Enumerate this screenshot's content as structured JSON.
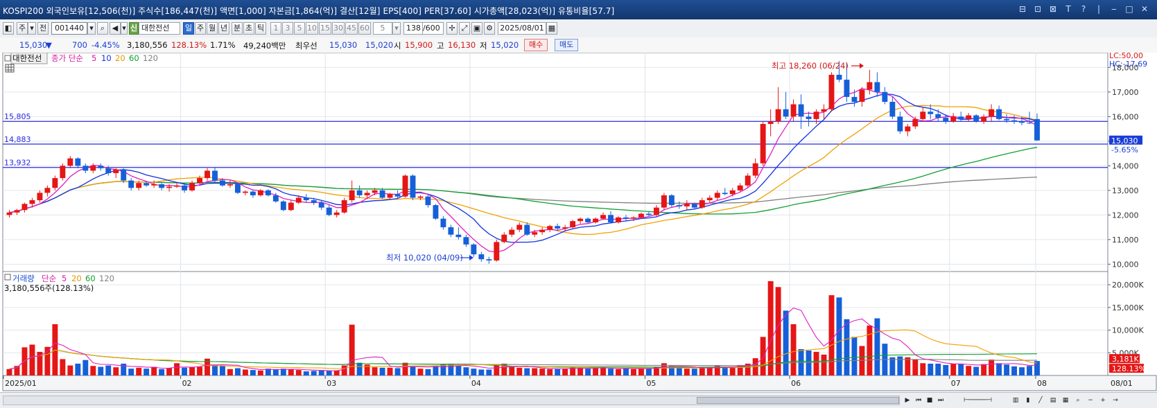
{
  "window": {
    "title": "KOSPI200 외국인보유[12,506(천)] 주식수[186,447(천)] 액면[1,000] 자본금[1,864(억)] 결산[12월] EPS[400] PER[37.60] 시가총액[28,023(억)] 유통비율[57.7]"
  },
  "toolbar": {
    "mode_ju": "주",
    "mode_jeon": "전",
    "stock_code": "001440",
    "new_badge": "신",
    "stock_name": "대한전선",
    "periods": [
      "일",
      "주",
      "월",
      "년",
      "분",
      "초",
      "틱"
    ],
    "period_active": "일",
    "intervals": [
      "1",
      "3",
      "5",
      "10",
      "15",
      "30",
      "45",
      "60"
    ],
    "interval_value": "5",
    "count": "138",
    "count_total": "/600",
    "date": "2025/08/01"
  },
  "quote": {
    "price": "15,030",
    "change_arrow": "▼",
    "change": "700",
    "change_pct": "-4.45%",
    "volume": "3,180,556",
    "volume_ratio": "128.13%",
    "turnover": "1.71%",
    "trade_value": "49,240백만",
    "best_label": "최우선",
    "best_ask": "15,030",
    "best_bid": "15,020",
    "open_label": "시",
    "open": "15,900",
    "high_label": "고",
    "high": "16,130",
    "low_label": "저",
    "low": "15,020",
    "buy_label": "매수",
    "sell_label": "매도"
  },
  "price_pane": {
    "stock_tag": "대한전선",
    "legend_prefix": "종가 단순",
    "ma_periods": [
      "5",
      "10",
      "20",
      "60",
      "120"
    ],
    "ma_colors": [
      "#e020c0",
      "#1030e0",
      "#f0a000",
      "#10a030",
      "#808080"
    ],
    "lc_label": "LC:50,00",
    "hc_label": "HC:-17,69",
    "hlines": [
      "15,805",
      "14,883",
      "13,932"
    ],
    "current_price_tag": "15,030",
    "current_pct_tag": "-5.65%",
    "high_annotation": "최고 18,260 (06/24)",
    "low_annotation": "최저 10,020 (04/09)",
    "y_ticks": [
      "18,000",
      "17,000",
      "16,000",
      "15,000",
      "14,000",
      "13,000",
      "12,000",
      "11,000",
      "10,000"
    ]
  },
  "volume_pane": {
    "legend_prefix": "거래량",
    "legend_simple": "단순",
    "ma_periods": [
      "5",
      "20",
      "60",
      "120"
    ],
    "volume_readout": "3,180,556주(128.13%)",
    "y_ticks": [
      "20,000K",
      "15,000K",
      "10,000K",
      "5,000K"
    ],
    "current_tag": "3,181K",
    "current_pct": "128.13%"
  },
  "x_axis": {
    "labels": [
      "2025/01",
      "02",
      "03",
      "04",
      "05",
      "06",
      "07",
      "08",
      "08/01"
    ]
  },
  "chart_data": {
    "type": "candlestick",
    "y_range": [
      9700,
      18600
    ],
    "up_color": "#e51616",
    "down_color": "#1560d8",
    "candles": [
      [
        12000,
        12200,
        11900,
        12100
      ],
      [
        12100,
        12250,
        12000,
        12200
      ],
      [
        12200,
        12500,
        12100,
        12450
      ],
      [
        12450,
        12700,
        12300,
        12600
      ],
      [
        12600,
        13000,
        12500,
        12900
      ],
      [
        12900,
        13200,
        12750,
        13100
      ],
      [
        13100,
        13600,
        13000,
        13500
      ],
      [
        13500,
        14100,
        13400,
        14000
      ],
      [
        14000,
        14400,
        13900,
        14300
      ],
      [
        14300,
        14350,
        13900,
        14000
      ],
      [
        14000,
        14100,
        13700,
        13800
      ],
      [
        13800,
        14100,
        13700,
        14000
      ],
      [
        14000,
        14100,
        13800,
        13900
      ],
      [
        13900,
        14000,
        13600,
        13700
      ],
      [
        13700,
        13900,
        13500,
        13850
      ],
      [
        13850,
        13900,
        13300,
        13400
      ],
      [
        13400,
        13500,
        13000,
        13100
      ],
      [
        13100,
        13400,
        13000,
        13300
      ],
      [
        13300,
        13350,
        13150,
        13200
      ],
      [
        13200,
        13400,
        13100,
        13250
      ],
      [
        13250,
        13300,
        13000,
        13100
      ],
      [
        13100,
        13250,
        12950,
        13150
      ],
      [
        13150,
        13300,
        13100,
        13200
      ],
      [
        13200,
        13250,
        12900,
        13000
      ],
      [
        13000,
        13400,
        12950,
        13300
      ],
      [
        13300,
        13600,
        13250,
        13500
      ],
      [
        13500,
        13900,
        13400,
        13800
      ],
      [
        13800,
        13950,
        13300,
        13400
      ],
      [
        13400,
        13500,
        13150,
        13200
      ],
      [
        13200,
        13400,
        13100,
        13250
      ],
      [
        13250,
        13300,
        12850,
        12900
      ],
      [
        12900,
        13000,
        12800,
        12950
      ],
      [
        12950,
        13000,
        12700,
        12800
      ],
      [
        12800,
        13050,
        12750,
        13000
      ],
      [
        13000,
        13050,
        12750,
        12800
      ],
      [
        12800,
        12900,
        12500,
        12550
      ],
      [
        12550,
        12600,
        12150,
        12200
      ],
      [
        12200,
        12600,
        12150,
        12500
      ],
      [
        12500,
        12800,
        12450,
        12700
      ],
      [
        12700,
        12850,
        12500,
        12600
      ],
      [
        12600,
        12700,
        12400,
        12500
      ],
      [
        12500,
        12600,
        12200,
        12300
      ],
      [
        12300,
        12400,
        11950,
        12000
      ],
      [
        12000,
        12200,
        11900,
        12100
      ],
      [
        12100,
        12700,
        12050,
        12600
      ],
      [
        12600,
        13400,
        12500,
        13000
      ],
      [
        13000,
        13200,
        12700,
        12800
      ],
      [
        12800,
        13000,
        12650,
        12900
      ],
      [
        12900,
        13100,
        12800,
        13000
      ],
      [
        13000,
        13100,
        12650,
        12700
      ],
      [
        12700,
        12900,
        12650,
        12850
      ],
      [
        12850,
        13000,
        12700,
        12750
      ],
      [
        12750,
        13650,
        12700,
        13600
      ],
      [
        13600,
        13650,
        12600,
        12700
      ],
      [
        12700,
        12800,
        12600,
        12750
      ],
      [
        12750,
        12850,
        12300,
        12400
      ],
      [
        12400,
        12450,
        11800,
        11850
      ],
      [
        11850,
        11950,
        11400,
        11500
      ],
      [
        11500,
        11600,
        11100,
        11200
      ],
      [
        11200,
        11500,
        11000,
        11100
      ],
      [
        11100,
        11200,
        10700,
        10800
      ],
      [
        10800,
        10850,
        10300,
        10400
      ],
      [
        10400,
        10500,
        10100,
        10200
      ],
      [
        10200,
        10300,
        10020,
        10150
      ],
      [
        10150,
        11000,
        10100,
        10900
      ],
      [
        10900,
        11300,
        10850,
        11200
      ],
      [
        11200,
        11500,
        11100,
        11400
      ],
      [
        11400,
        11700,
        11300,
        11600
      ],
      [
        11600,
        11700,
        11150,
        11200
      ],
      [
        11200,
        11400,
        11100,
        11300
      ],
      [
        11300,
        11500,
        11200,
        11400
      ],
      [
        11400,
        11600,
        11300,
        11550
      ],
      [
        11550,
        11650,
        11350,
        11450
      ],
      [
        11450,
        11600,
        11350,
        11500
      ],
      [
        11500,
        11800,
        11450,
        11750
      ],
      [
        11750,
        11900,
        11650,
        11850
      ],
      [
        11850,
        11900,
        11650,
        11700
      ],
      [
        11700,
        11900,
        11650,
        11850
      ],
      [
        11850,
        12100,
        11800,
        12000
      ],
      [
        12000,
        12150,
        11650,
        11700
      ],
      [
        11700,
        11950,
        11650,
        11900
      ],
      [
        11900,
        12000,
        11750,
        11850
      ],
      [
        11850,
        11950,
        11750,
        11900
      ],
      [
        11900,
        12100,
        11850,
        12050
      ],
      [
        12050,
        12150,
        11950,
        12000
      ],
      [
        12000,
        12400,
        11950,
        12300
      ],
      [
        12300,
        12900,
        12200,
        12800
      ],
      [
        12800,
        12850,
        12300,
        12400
      ],
      [
        12400,
        12550,
        12250,
        12350
      ],
      [
        12350,
        12600,
        12200,
        12450
      ],
      [
        12450,
        12500,
        12250,
        12300
      ],
      [
        12300,
        12700,
        12250,
        12600
      ],
      [
        12600,
        12800,
        12500,
        12700
      ],
      [
        12700,
        13000,
        12600,
        12900
      ],
      [
        12900,
        13100,
        12800,
        12850
      ],
      [
        12850,
        13100,
        12750,
        13000
      ],
      [
        13000,
        13300,
        12950,
        13200
      ],
      [
        13200,
        13700,
        13100,
        13600
      ],
      [
        13600,
        14300,
        13500,
        14100
      ],
      [
        14100,
        15800,
        14000,
        15700
      ],
      [
        15700,
        16300,
        15200,
        15800
      ],
      [
        15800,
        17200,
        15700,
        16300
      ],
      [
        16300,
        17000,
        15900,
        16000
      ],
      [
        16000,
        16700,
        15800,
        16500
      ],
      [
        16500,
        16900,
        15500,
        16000
      ],
      [
        16000,
        16200,
        15600,
        15900
      ],
      [
        15900,
        16300,
        15700,
        16200
      ],
      [
        16200,
        16500,
        15900,
        16300
      ],
      [
        16300,
        17800,
        16200,
        17700
      ],
      [
        17700,
        18260,
        17400,
        17500
      ],
      [
        17500,
        18200,
        16600,
        16800
      ],
      [
        16800,
        17100,
        16400,
        16600
      ],
      [
        16600,
        17200,
        16400,
        17100
      ],
      [
        17100,
        17900,
        16900,
        17400
      ],
      [
        17400,
        17800,
        16800,
        17000
      ],
      [
        17000,
        17200,
        16500,
        16600
      ],
      [
        16600,
        16800,
        15900,
        16000
      ],
      [
        16000,
        16200,
        15300,
        15400
      ],
      [
        15400,
        15700,
        15200,
        15600
      ],
      [
        15600,
        16000,
        15500,
        15900
      ],
      [
        15900,
        16400,
        15800,
        16200
      ],
      [
        16200,
        16500,
        15900,
        16100
      ],
      [
        16100,
        16300,
        15800,
        15950
      ],
      [
        15950,
        16100,
        15700,
        15800
      ],
      [
        15800,
        16150,
        15750,
        16000
      ],
      [
        16000,
        16200,
        15800,
        15900
      ],
      [
        15900,
        16150,
        15800,
        16050
      ],
      [
        16050,
        16100,
        15750,
        15800
      ],
      [
        15800,
        16100,
        15700,
        16000
      ],
      [
        16000,
        16500,
        15800,
        16300
      ],
      [
        16300,
        16450,
        15850,
        15900
      ],
      [
        15900,
        16100,
        15750,
        15850
      ],
      [
        15850,
        16050,
        15700,
        15800
      ],
      [
        15800,
        16000,
        15650,
        15750
      ],
      [
        15750,
        16200,
        15700,
        15730
      ],
      [
        15900,
        16130,
        15020,
        15030
      ]
    ],
    "volumes_k": [
      1400,
      2100,
      6200,
      6800,
      5200,
      6300,
      11300,
      3600,
      2200,
      2600,
      3400,
      2100,
      1900,
      2200,
      1800,
      2600,
      1500,
      1700,
      1500,
      1900,
      1400,
      1600,
      2700,
      1700,
      1800,
      1900,
      3700,
      2400,
      2100,
      1400,
      1600,
      1300,
      1200,
      1100,
      1500,
      1400,
      1500,
      1300,
      1200,
      900,
      1000,
      1200,
      1000,
      1100,
      2200,
      11200,
      2800,
      2400,
      1800,
      1700,
      1700,
      1600,
      2800,
      2000,
      1500,
      1400,
      2100,
      2400,
      2600,
      2100,
      1800,
      1500,
      1300,
      1300,
      2400,
      2600,
      1900,
      1700,
      1600,
      1600,
      1500,
      1400,
      1400,
      1500,
      1800,
      1700,
      1500,
      1600,
      1800,
      1500,
      1400,
      1600,
      1400,
      1600,
      1600,
      1900,
      2700,
      2100,
      1700,
      1500,
      1500,
      1600,
      1900,
      2100,
      1800,
      1900,
      2300,
      2600,
      3800,
      8500,
      20800,
      19500,
      14300,
      11300,
      5800,
      5500,
      5200,
      4600,
      17700,
      17200,
      12400,
      8500,
      6500,
      11000,
      12600,
      7000,
      4000,
      4200,
      4000,
      3500,
      2700,
      2600,
      2600,
      2300,
      2600,
      2600,
      2100,
      1900,
      2500,
      3500,
      2700,
      2400,
      2000,
      1800,
      2100,
      3181
    ],
    "month_labels": [
      "2025/01",
      "02",
      "03",
      "04",
      "05",
      "06",
      "07",
      "08"
    ],
    "month_start_index": [
      0,
      23,
      42,
      61,
      84,
      103,
      124,
      138
    ]
  }
}
